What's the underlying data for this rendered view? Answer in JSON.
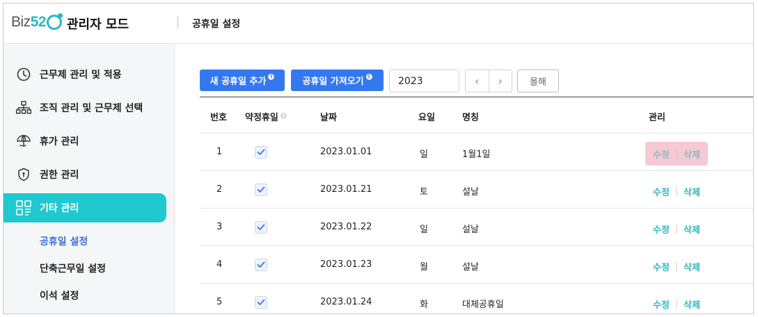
{
  "header": {
    "logo_text": "Biz",
    "logo_num": "52",
    "app_title": "관리자 모드",
    "page_title": "공휴일 설정"
  },
  "sidebar": {
    "items": [
      {
        "label": "근무제 관리 및 적용",
        "icon": "clock-icon"
      },
      {
        "label": "조직 관리 및 근무제 선택",
        "icon": "org-chart-icon"
      },
      {
        "label": "휴가 관리",
        "icon": "umbrella-icon"
      },
      {
        "label": "권한 관리",
        "icon": "shield-icon"
      },
      {
        "label": "기타 관리",
        "icon": "grid-icon",
        "active": true
      }
    ],
    "sub_items": [
      {
        "label": "공휴일 설정",
        "active": true
      },
      {
        "label": "단축근무일 설정"
      },
      {
        "label": "이석 설정"
      }
    ]
  },
  "toolbar": {
    "add_label": "새 공휴일 추가",
    "import_label": "공휴일 가져오기",
    "info_mark": "i",
    "year_value": "2023",
    "prev_glyph": "‹",
    "next_glyph": "›",
    "this_year_label": "올해"
  },
  "table": {
    "headers": {
      "no": "번호",
      "contract": "약정휴일",
      "date": "날짜",
      "weekday": "요일",
      "name": "명칭",
      "manage": "관리"
    },
    "edit_label": "수정",
    "delete_label": "삭제",
    "separator": "|",
    "rows": [
      {
        "no": "1",
        "checked": true,
        "date": "2023.01.01",
        "weekday": "일",
        "name": "1월1일"
      },
      {
        "no": "2",
        "checked": true,
        "date": "2023.01.21",
        "weekday": "토",
        "name": "설날"
      },
      {
        "no": "3",
        "checked": true,
        "date": "2023.01.22",
        "weekday": "일",
        "name": "설날"
      },
      {
        "no": "4",
        "checked": true,
        "date": "2023.01.23",
        "weekday": "월",
        "name": "설날"
      },
      {
        "no": "5",
        "checked": true,
        "date": "2023.01.24",
        "weekday": "화",
        "name": "대체공휴일"
      }
    ]
  },
  "colors": {
    "accent_teal": "#20c9cf",
    "primary_blue": "#3478f0",
    "active_sub": "#3a6fd8",
    "row_highlight": "#f6c9d3"
  }
}
